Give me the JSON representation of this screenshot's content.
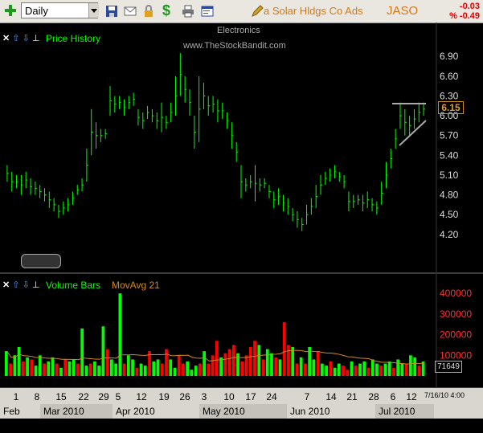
{
  "toolbar": {
    "period": "Daily",
    "description": "a Solar Hldgs Co Ads",
    "symbol": "JASO",
    "change": "-0.03",
    "change_pct": "% -0.49"
  },
  "price_panel": {
    "title": "Price History",
    "sector": "Electronics",
    "watermark": "www.TheStockBandit.com",
    "last_price": "6.15",
    "y_ticks": [
      "6.90",
      "6.60",
      "6.30",
      "6.00",
      "5.70",
      "5.40",
      "5.10",
      "4.80",
      "4.50",
      "4.20"
    ]
  },
  "volume_panel": {
    "title": "Volume Bars",
    "ma_label": "MovAvg 21",
    "y_ticks": [
      "400000",
      "300000",
      "200000",
      "100000"
    ],
    "last_volume": "71649"
  },
  "x_axis": {
    "day_ticks": [
      "1",
      "8",
      "15",
      "22",
      "29",
      "5",
      "12",
      "19",
      "26",
      "3",
      "10",
      "17",
      "24",
      "7",
      "14",
      "21",
      "28",
      "6",
      "12"
    ],
    "date_stamp": "7/16/10 4:00",
    "months": [
      "Feb 2010",
      "Mar 2010",
      "Apr 2010",
      "May 2010",
      "Jun 2010",
      "Jul 2010"
    ]
  },
  "colors": {
    "price": "#00ff00",
    "volume_up": "#00ff00",
    "volume_down": "#ff0000",
    "ma": "#d08a20",
    "accent": "#d07a1a"
  },
  "chart_data": [
    {
      "type": "bar",
      "title": "Price History",
      "ylim": [
        4.1,
        7.0
      ],
      "ohlc_approx_highlows": [
        [
          5.0,
          5.25
        ],
        [
          4.85,
          5.15
        ],
        [
          4.9,
          5.1
        ],
        [
          4.8,
          5.1
        ],
        [
          4.9,
          5.15
        ],
        [
          4.8,
          5.05
        ],
        [
          4.8,
          5.0
        ],
        [
          4.75,
          4.95
        ],
        [
          4.7,
          4.9
        ],
        [
          4.6,
          4.85
        ],
        [
          4.55,
          4.75
        ],
        [
          4.45,
          4.65
        ],
        [
          4.5,
          4.7
        ],
        [
          4.55,
          4.75
        ],
        [
          4.65,
          4.85
        ],
        [
          4.8,
          4.95
        ],
        [
          4.85,
          5.05
        ],
        [
          5.0,
          5.5
        ],
        [
          5.4,
          6.1
        ],
        [
          5.5,
          5.9
        ],
        [
          5.6,
          5.8
        ],
        [
          5.65,
          5.8
        ],
        [
          6.0,
          6.45
        ],
        [
          6.05,
          6.3
        ],
        [
          6.1,
          6.3
        ],
        [
          6.0,
          6.25
        ],
        [
          6.1,
          6.3
        ],
        [
          6.15,
          6.35
        ],
        [
          5.85,
          6.1
        ],
        [
          5.8,
          6.05
        ],
        [
          5.95,
          6.15
        ],
        [
          5.9,
          6.1
        ],
        [
          5.8,
          6.05
        ],
        [
          5.75,
          6.2
        ],
        [
          5.8,
          6.0
        ],
        [
          5.9,
          6.2
        ],
        [
          6.0,
          6.6
        ],
        [
          6.3,
          6.95
        ],
        [
          6.2,
          6.6
        ],
        [
          6.0,
          6.4
        ],
        [
          5.5,
          6.0
        ],
        [
          5.6,
          6.6
        ],
        [
          6.1,
          6.5
        ],
        [
          6.0,
          6.3
        ],
        [
          6.05,
          6.3
        ],
        [
          5.9,
          6.25
        ],
        [
          5.95,
          6.2
        ],
        [
          5.8,
          6.05
        ],
        [
          5.5,
          5.9
        ],
        [
          5.3,
          5.6
        ],
        [
          4.75,
          5.25
        ],
        [
          4.85,
          5.05
        ],
        [
          4.9,
          5.1
        ],
        [
          4.7,
          5.25
        ],
        [
          4.85,
          5.05
        ],
        [
          4.9,
          5.05
        ],
        [
          4.75,
          4.95
        ],
        [
          4.6,
          4.85
        ],
        [
          4.65,
          4.9
        ],
        [
          4.55,
          4.8
        ],
        [
          4.5,
          4.75
        ],
        [
          4.4,
          4.6
        ],
        [
          4.3,
          4.55
        ],
        [
          4.25,
          4.45
        ],
        [
          4.35,
          4.65
        ],
        [
          4.5,
          4.75
        ],
        [
          4.6,
          4.95
        ],
        [
          4.8,
          5.1
        ],
        [
          4.95,
          5.15
        ],
        [
          5.0,
          5.2
        ],
        [
          5.05,
          5.25
        ],
        [
          5.0,
          5.15
        ],
        [
          4.9,
          5.1
        ],
        [
          4.55,
          4.85
        ],
        [
          4.6,
          4.8
        ],
        [
          4.65,
          4.8
        ],
        [
          4.55,
          4.8
        ],
        [
          4.6,
          4.85
        ],
        [
          4.55,
          4.75
        ],
        [
          4.5,
          4.7
        ],
        [
          4.65,
          5.0
        ],
        [
          4.9,
          5.3
        ],
        [
          5.2,
          5.5
        ],
        [
          5.5,
          5.8
        ],
        [
          5.8,
          6.2
        ],
        [
          5.7,
          6.1
        ],
        [
          5.7,
          6.0
        ],
        [
          5.8,
          6.1
        ],
        [
          5.9,
          6.2
        ],
        [
          6.0,
          6.2
        ]
      ]
    },
    {
      "type": "bar",
      "title": "Volume Bars",
      "ylim": [
        0,
        420000
      ],
      "volumes": [
        120000,
        60000,
        100000,
        140000,
        70000,
        90000,
        80000,
        50000,
        100000,
        60000,
        70000,
        90000,
        60000,
        40000,
        80000,
        70000,
        80000,
        60000,
        230000,
        50000,
        60000,
        70000,
        50000,
        240000,
        130000,
        80000,
        60000,
        400000,
        60000,
        100000,
        80000,
        40000,
        60000,
        50000,
        120000,
        70000,
        80000,
        60000,
        130000,
        80000,
        40000,
        100000,
        60000,
        70000,
        30000,
        50000,
        60000,
        120000,
        60000,
        100000,
        170000,
        90000,
        110000,
        130000,
        150000,
        110000,
        70000,
        100000,
        140000,
        170000,
        150000,
        80000,
        130000,
        110000,
        90000,
        80000,
        260000,
        150000,
        140000,
        60000,
        90000,
        60000,
        140000,
        80000,
        120000,
        60000,
        50000,
        70000,
        40000,
        60000,
        50000,
        30000,
        70000,
        50000,
        60000,
        70000,
        40000,
        80000,
        60000,
        50000,
        60000,
        70000,
        40000,
        80000,
        60000,
        60000,
        100000,
        90000,
        50000,
        70000
      ],
      "up": [
        1,
        0,
        1,
        1,
        0,
        1,
        0,
        1,
        1,
        0,
        1,
        1,
        0,
        1,
        0,
        1,
        1,
        0,
        1,
        1,
        0,
        1,
        1,
        1,
        0,
        1,
        1,
        1,
        0,
        1,
        1,
        0,
        1,
        1,
        0,
        1,
        1,
        0,
        0,
        1,
        1,
        0,
        0,
        1,
        1,
        1,
        0,
        1,
        0,
        0,
        0,
        1,
        0,
        0,
        0,
        1,
        0,
        0,
        0,
        0,
        1,
        0,
        1,
        1,
        0,
        1,
        0,
        0,
        1,
        0,
        1,
        0,
        1,
        1,
        0,
        1,
        1,
        0,
        1,
        1,
        0,
        0,
        1,
        0,
        1,
        1,
        0,
        1,
        1,
        0,
        1,
        1,
        0,
        1,
        1,
        0,
        1,
        1,
        0,
        1
      ]
    }
  ]
}
